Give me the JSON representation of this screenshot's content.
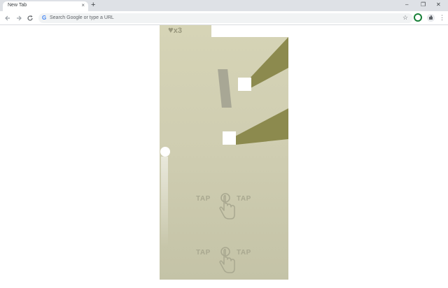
{
  "browser": {
    "tab_title": "New Tab",
    "tab_close": "×",
    "new_tab": "+",
    "window_controls": {
      "minimize": "–",
      "restore": "❐",
      "close": "✕"
    },
    "omnibox_placeholder": "Search Google or type a URL",
    "google_glyph": "G",
    "star_glyph": "☆",
    "menu_glyph": "⋮"
  },
  "game": {
    "lives_glyph": "♥",
    "lives_count": "x3",
    "tap_rows": [
      {
        "left": "TAP",
        "right": "TAP"
      },
      {
        "left": "TAP",
        "right": "TAP"
      }
    ],
    "colors": {
      "background": "#d2d0b3",
      "ramp": "#8c8a4e",
      "block": "#ffffff",
      "hint_text": "#a9a890"
    }
  }
}
